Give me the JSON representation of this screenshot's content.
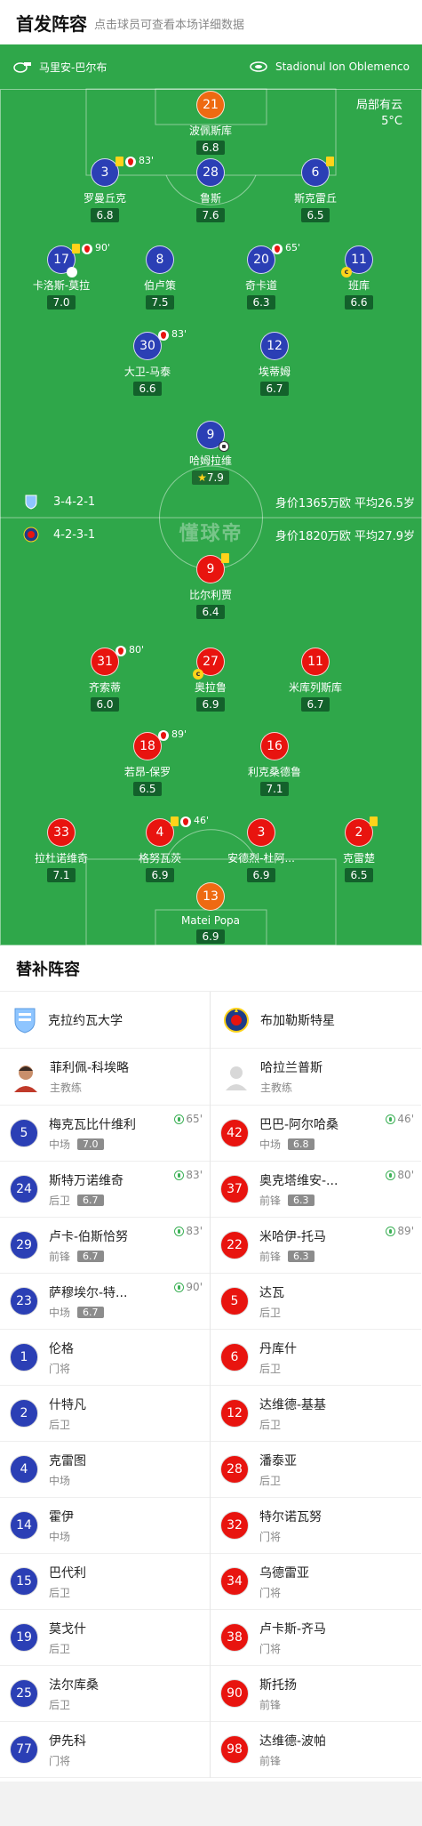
{
  "header": {
    "title": "首发阵容",
    "subtitle": "点击球员可查看本场详细数据"
  },
  "venue": {
    "coach_home": "马里安-巴尔布",
    "stadium": "Stadionul Ion Oblemenco"
  },
  "weather": {
    "condition": "局部有云",
    "temp": "5°C"
  },
  "colors": {
    "pitch": "#2fa74a",
    "home": "#2b3fb5",
    "away": "#e8140f",
    "gk_home": "#ee6a12"
  },
  "home_team": {
    "formation": "3-4-2-1",
    "value": "身价1365万欧 平均26.5岁"
  },
  "away_team": {
    "formation": "4-2-3-1",
    "value": "身价1820万欧 平均27.9岁"
  },
  "watermark": "懂球帝",
  "home_players": [
    {
      "num": "21",
      "name": "波佩斯库",
      "rating": "6.8"
    },
    {
      "num": "3",
      "name": "罗曼丘克",
      "rating": "6.8",
      "sub": "83'"
    },
    {
      "num": "28",
      "name": "鲁斯",
      "rating": "7.6"
    },
    {
      "num": "6",
      "name": "斯克雷丘",
      "rating": "6.5"
    },
    {
      "num": "17",
      "name": "卡洛斯-莫拉",
      "rating": "7.0",
      "sub": "90'"
    },
    {
      "num": "8",
      "name": "伯卢策",
      "rating": "7.5"
    },
    {
      "num": "20",
      "name": "奇卡道",
      "rating": "6.3",
      "sub": "65'"
    },
    {
      "num": "11",
      "name": "班库",
      "rating": "6.6"
    },
    {
      "num": "30",
      "name": "大卫-马泰",
      "rating": "6.6",
      "sub": "83'"
    },
    {
      "num": "12",
      "name": "埃蒂姆",
      "rating": "6.7"
    },
    {
      "num": "9",
      "name": "哈姆拉维",
      "rating": "7.9"
    }
  ],
  "away_players": [
    {
      "num": "9",
      "name": "比尔利贾",
      "rating": "6.4"
    },
    {
      "num": "31",
      "name": "齐索蒂",
      "rating": "6.0",
      "sub": "80'"
    },
    {
      "num": "27",
      "name": "奥拉鲁",
      "rating": "6.9"
    },
    {
      "num": "11",
      "name": "米库列斯库",
      "rating": "6.7"
    },
    {
      "num": "18",
      "name": "若昂-保罗",
      "rating": "6.5",
      "sub": "89'"
    },
    {
      "num": "16",
      "name": "利克桑德鲁",
      "rating": "7.1"
    },
    {
      "num": "33",
      "name": "拉杜诺维奇",
      "rating": "7.1"
    },
    {
      "num": "4",
      "name": "格努瓦茨",
      "rating": "6.9",
      "sub": "46'"
    },
    {
      "num": "3",
      "name": "安德烈-杜阿...",
      "rating": "6.9"
    },
    {
      "num": "2",
      "name": "克雷楚",
      "rating": "6.5"
    },
    {
      "num": "13",
      "name": "Matei Popa",
      "rating": "6.9"
    }
  ],
  "subs": {
    "title": "替补阵容",
    "home": {
      "team": "克拉约瓦大学",
      "coach": {
        "name": "菲利佩-科埃略",
        "role": "主教练"
      },
      "players": [
        {
          "num": "5",
          "name": "梅克瓦比什维利",
          "pos": "中场",
          "rating": "7.0",
          "in": "65'"
        },
        {
          "num": "24",
          "name": "斯特万诺维奇",
          "pos": "后卫",
          "rating": "6.7",
          "in": "83'"
        },
        {
          "num": "29",
          "name": "卢卡-伯斯恰努",
          "pos": "前锋",
          "rating": "6.7",
          "in": "83'"
        },
        {
          "num": "23",
          "name": "萨穆埃尔-特...",
          "pos": "中场",
          "rating": "6.7",
          "in": "90'"
        },
        {
          "num": "1",
          "name": "伦格",
          "pos": "门将"
        },
        {
          "num": "2",
          "name": "什特凡",
          "pos": "后卫"
        },
        {
          "num": "4",
          "name": "克雷图",
          "pos": "中场"
        },
        {
          "num": "14",
          "name": "霍伊",
          "pos": "中场"
        },
        {
          "num": "15",
          "name": "巴代利",
          "pos": "后卫"
        },
        {
          "num": "19",
          "name": "莫戈什",
          "pos": "后卫"
        },
        {
          "num": "25",
          "name": "法尔库桑",
          "pos": "后卫"
        },
        {
          "num": "77",
          "name": "伊先科",
          "pos": "门将"
        }
      ]
    },
    "away": {
      "team": "布加勒斯特星",
      "coach": {
        "name": "哈拉兰普斯",
        "role": "主教练"
      },
      "players": [
        {
          "num": "42",
          "name": "巴巴-阿尔哈桑",
          "pos": "中场",
          "rating": "6.8",
          "in": "46'"
        },
        {
          "num": "37",
          "name": "奥克塔维安-...",
          "pos": "前锋",
          "rating": "6.3",
          "in": "80'"
        },
        {
          "num": "22",
          "name": "米哈伊-托马",
          "pos": "前锋",
          "rating": "6.3",
          "in": "89'"
        },
        {
          "num": "5",
          "name": "达瓦",
          "pos": "后卫"
        },
        {
          "num": "6",
          "name": "丹库什",
          "pos": "后卫"
        },
        {
          "num": "12",
          "name": "达维德-基基",
          "pos": "后卫"
        },
        {
          "num": "28",
          "name": "潘泰亚",
          "pos": "后卫"
        },
        {
          "num": "32",
          "name": "特尔诺瓦努",
          "pos": "门将"
        },
        {
          "num": "34",
          "name": "乌德雷亚",
          "pos": "门将"
        },
        {
          "num": "38",
          "name": "卢卡斯-齐马",
          "pos": "门将"
        },
        {
          "num": "90",
          "name": "斯托扬",
          "pos": "前锋"
        },
        {
          "num": "98",
          "name": "达维德-波帕",
          "pos": "前锋"
        }
      ]
    }
  }
}
